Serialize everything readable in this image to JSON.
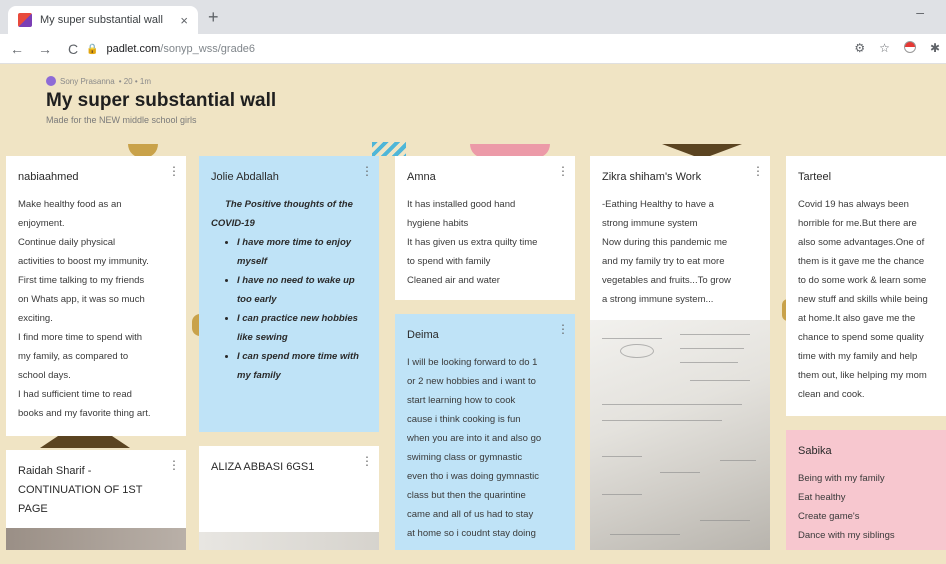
{
  "browser": {
    "tab_title": "My super substantial wall",
    "tab_close": "×",
    "new_tab": "+",
    "minimize": "–",
    "back": "←",
    "forward": "→",
    "reload": "C",
    "lock": "🔒",
    "url_host": "padlet.com",
    "url_path": "/sonyp_wss/grade6",
    "icons": [
      "settings-icon",
      "star-icon",
      "profile-icon",
      "extensions-icon"
    ]
  },
  "wall": {
    "author": "Sony Prasanna",
    "author_meta": "• 20 • 1m",
    "title": "My super substantial wall",
    "description": "Made for the NEW middle school girls"
  },
  "cards": {
    "nabia": {
      "author": "nabiaahmed",
      "lines": [
        "Make healthy food as an",
        "enjoyment.",
        "Continue daily physical",
        "activities to boost my immunity.",
        "First time talking to my friends",
        "on Whats app, it was so much",
        "exciting.",
        "I find more time to spend with",
        "my family, as compared to",
        "school days.",
        "I had sufficient  time to read",
        "books and my favorite thing art."
      ]
    },
    "jolie": {
      "author": "Jolie Abdallah",
      "heading1": "The Positive thoughts of the",
      "heading2": "COVID-19",
      "bullets": [
        [
          "I have more time to enjoy",
          "myself"
        ],
        [
          "I have no need to wake up",
          "too early"
        ],
        [
          "I can practice new hobbies",
          "like sewing"
        ],
        [
          "I can spend more time with",
          "my family"
        ]
      ]
    },
    "amna": {
      "author": "Amna",
      "lines": [
        "It has installed good hand",
        "hygiene habits",
        "It has given us extra quilty time",
        "to spend with family",
        "Cleaned air and water"
      ]
    },
    "zikra": {
      "author": "Zikra shiham's Work",
      "lines": [
        "-Eathing Healthy to have a",
        "strong immune system",
        "Now during this pandemic me",
        "and my family try to eat more",
        "vegetables and fruits...To grow",
        "a strong immune system..."
      ]
    },
    "tarteel": {
      "author": "Tarteel",
      "lines": [
        "Covid 19 has always been",
        "horrible for me.But there are",
        "also some advantages.One of",
        "them is it gave me the chance",
        "to do some work & learn some",
        "new stuff and skills while being",
        "at home.It also gave me the",
        "chance to spend some quality",
        "time with my family and help",
        "them out, like helping my mom",
        "clean and cook."
      ]
    },
    "deima": {
      "author": "Deima",
      "lines": [
        "I will be looking forward to do 1",
        "or 2 new hobbies and i want to",
        "start learning how to cook",
        "cause i think cooking is fun",
        "when you are into it and also go",
        "swiming class or gymnastic",
        "even tho i was doing gymnastic",
        "class but then the quarintine",
        "came and all of us had to stay",
        "at home so i coudnt stay doing"
      ]
    },
    "raidah": {
      "author_lines": [
        "Raidah Sharif -",
        "CONTINUATION OF 1ST",
        "PAGE"
      ]
    },
    "aliza": {
      "author": "ALIZA ABBASI 6GS1"
    },
    "sabika": {
      "author": "Sabika",
      "lines": [
        "Being with my family",
        "Eat healthy",
        "Create game's",
        "Dance with my siblings"
      ]
    },
    "more_icon": "⋮"
  },
  "colors": {
    "wall_background": "#f0e4c4",
    "card_blue": "#bfe3f7",
    "card_pink": "#f7c7cf",
    "card_white": "#ffffff"
  }
}
